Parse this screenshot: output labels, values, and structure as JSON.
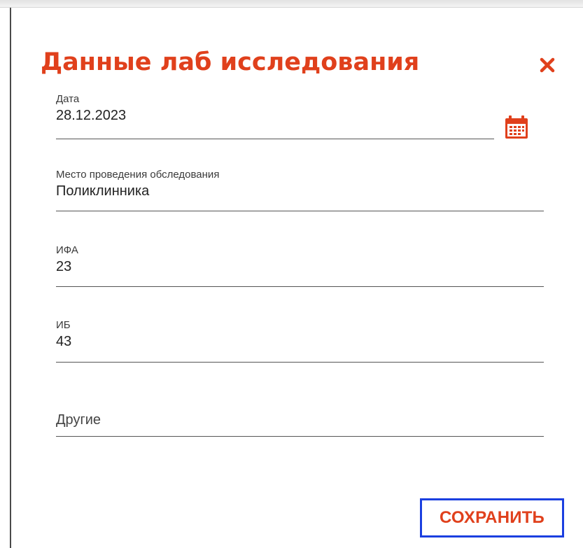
{
  "dialog": {
    "title": "Данные лаб исследования",
    "close_icon": "close-icon",
    "accent_color": "#e0401c",
    "focus_color": "#1b3fe0"
  },
  "fields": {
    "date": {
      "label": "Дата",
      "value": "28.12.2023",
      "icon": "calendar-icon"
    },
    "place": {
      "label": "Место проведения обследования",
      "value": "Поликлинника"
    },
    "ifa": {
      "label": "ИФА",
      "value": "23"
    },
    "ib": {
      "label": "ИБ",
      "value": "43"
    },
    "other": {
      "placeholder": "Другие",
      "value": ""
    }
  },
  "actions": {
    "save_label": "СОХРАНИТЬ"
  }
}
